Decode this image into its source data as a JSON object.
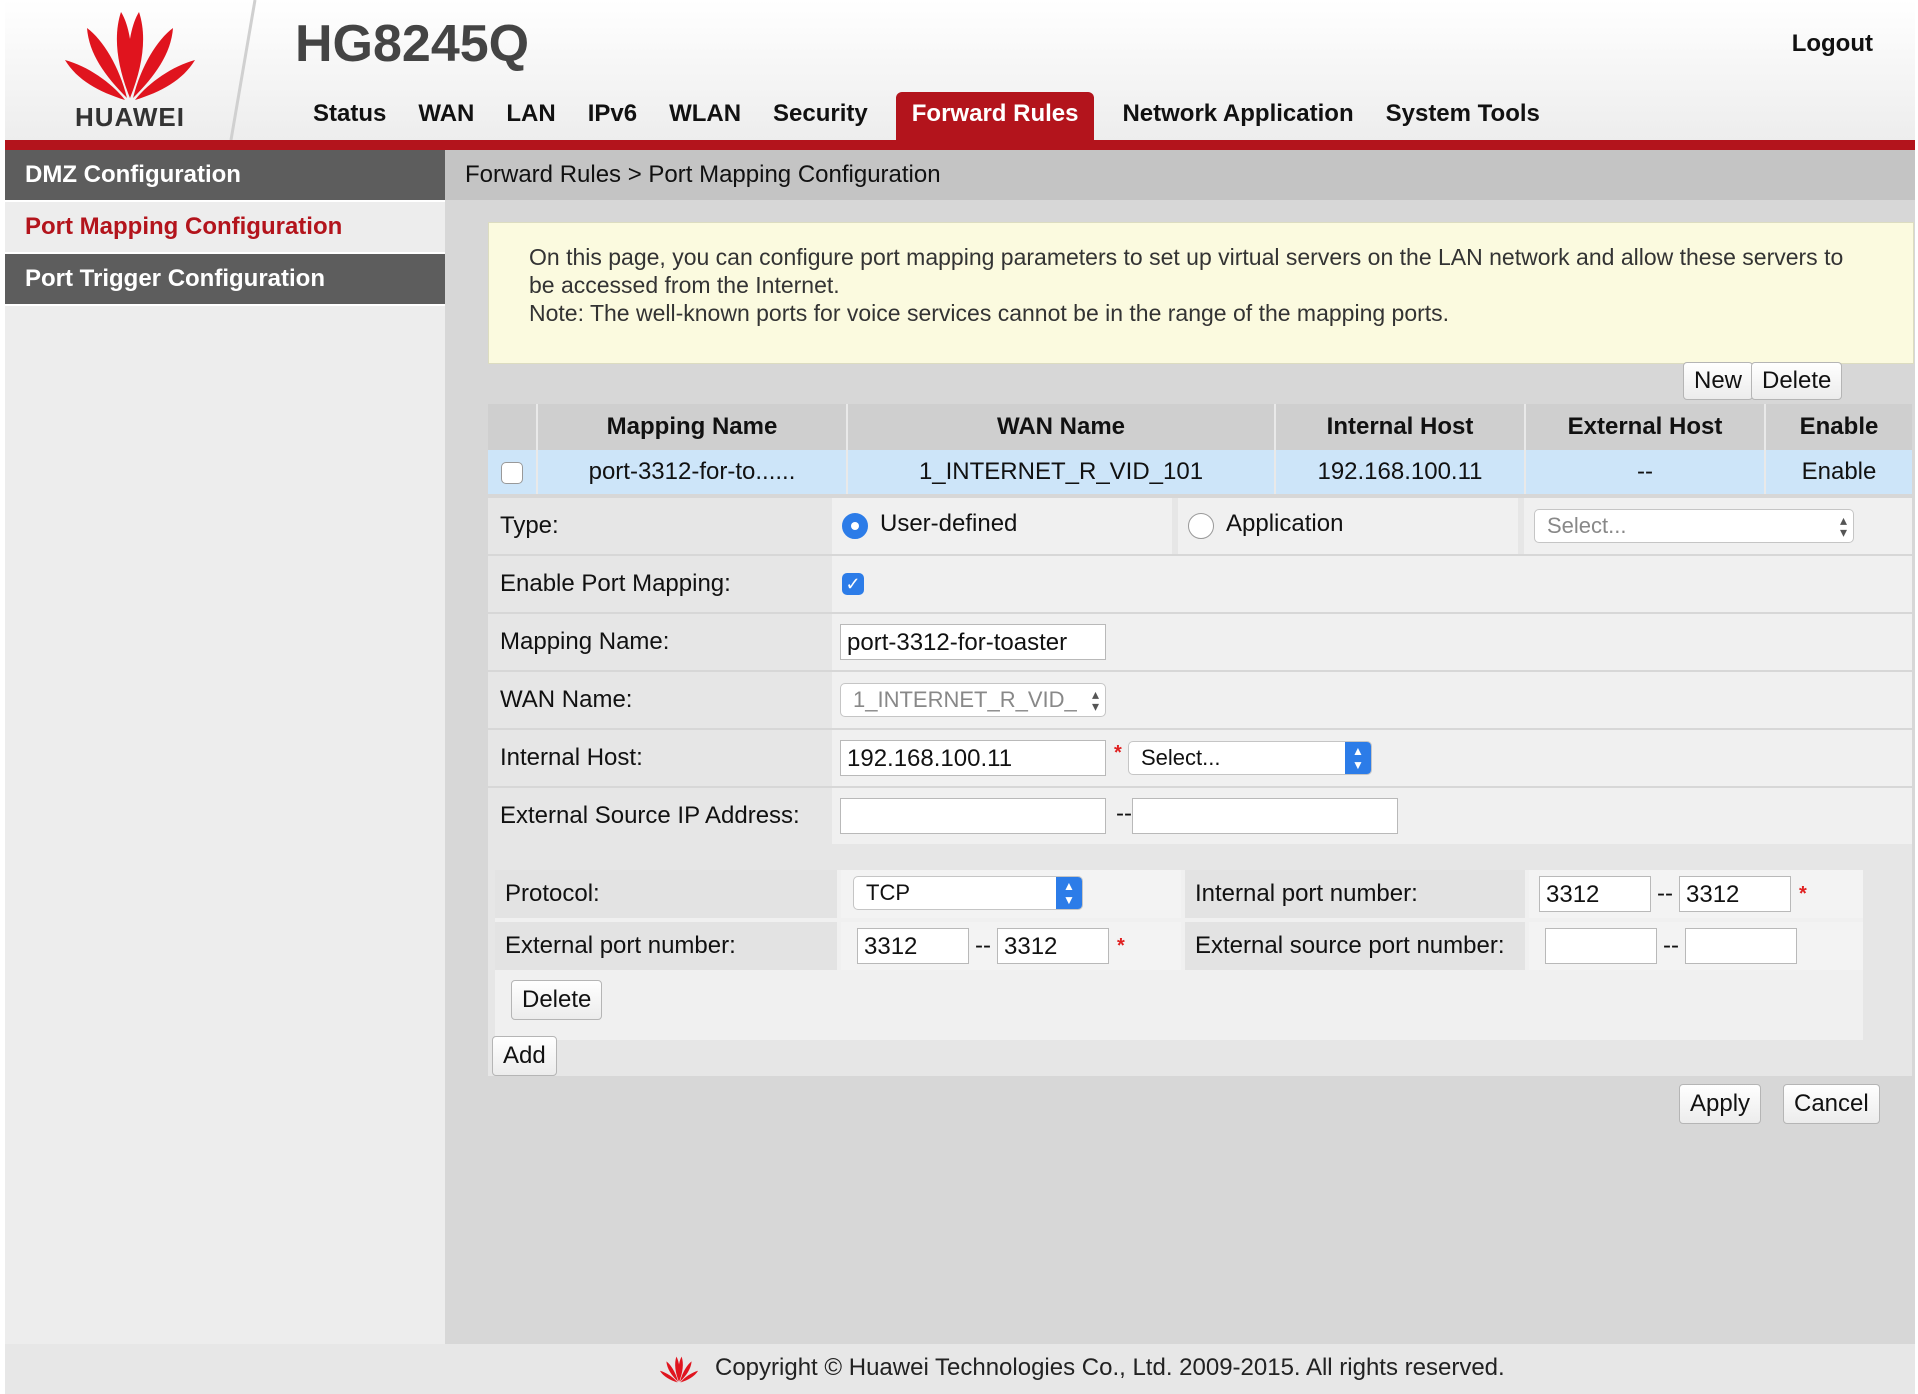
{
  "header": {
    "brand": "HUAWEI",
    "model": "HG8245Q",
    "logout": "Logout",
    "brand_color": "#b3141c"
  },
  "nav": {
    "items": [
      {
        "label": "Status"
      },
      {
        "label": "WAN"
      },
      {
        "label": "LAN"
      },
      {
        "label": "IPv6"
      },
      {
        "label": "WLAN"
      },
      {
        "label": "Security"
      },
      {
        "label": "Forward Rules",
        "active": true
      },
      {
        "label": "Network Application"
      },
      {
        "label": "System Tools"
      }
    ]
  },
  "sidebar": {
    "items": [
      {
        "label": "DMZ Configuration"
      },
      {
        "label": "Port Mapping Configuration",
        "active": true
      },
      {
        "label": "Port Trigger Configuration"
      }
    ]
  },
  "breadcrumb": "Forward Rules > Port Mapping Configuration",
  "notice": {
    "line1": "On this page, you can configure port mapping parameters to set up virtual servers on the LAN network and allow these servers to be accessed from the Internet.",
    "line2": "Note: The well-known ports for voice services cannot be in the range of the mapping ports."
  },
  "toolbar": {
    "new_label": "New",
    "delete_label": "Delete"
  },
  "summary_table": {
    "headers": [
      "Mapping Name",
      "WAN Name",
      "Internal Host",
      "External Host",
      "Enable"
    ],
    "rows": [
      {
        "mapping_name": "port-3312-for-to......",
        "wan_name": "1_INTERNET_R_VID_101",
        "internal_host": "192.168.100.11",
        "external_host": "--",
        "enable": "Enable",
        "checked": false
      }
    ]
  },
  "form": {
    "type_label": "Type:",
    "type_user_defined": "User-defined",
    "type_application": "Application",
    "type_selected": "User-defined",
    "app_select_placeholder": "Select...",
    "enable_label": "Enable Port Mapping:",
    "enable_checked": true,
    "mapping_name_label": "Mapping Name:",
    "mapping_name_value": "port-3312-for-toaster",
    "wan_name_label": "WAN Name:",
    "wan_name_value": "1_INTERNET_R_VID_",
    "internal_host_label": "Internal Host:",
    "internal_host_value": "192.168.100.11",
    "internal_host_select": "Select...",
    "ext_src_ip_label": "External Source IP Address:",
    "ext_src_ip_start": "",
    "ext_src_ip_end": "",
    "dash": "--",
    "required_mark": "*"
  },
  "ports": {
    "protocol_label": "Protocol:",
    "protocol_value": "TCP",
    "internal_port_label": "Internal port number:",
    "internal_port_start": "3312",
    "internal_port_end": "3312",
    "external_port_label": "External port number:",
    "external_port_start": "3312",
    "external_port_end": "3312",
    "ext_src_port_label": "External source port number:",
    "ext_src_port_start": "",
    "ext_src_port_end": "",
    "delete_label": "Delete"
  },
  "actions": {
    "add_label": "Add",
    "apply_label": "Apply",
    "cancel_label": "Cancel"
  },
  "footer": {
    "copyright": "Copyright © Huawei Technologies Co., Ltd. 2009-2015. All rights reserved."
  },
  "colors": {
    "accent_red": "#b3141c",
    "selected_row": "#cde5f9",
    "control_blue": "#2c7ce8",
    "notice_bg": "#fbfadf"
  }
}
